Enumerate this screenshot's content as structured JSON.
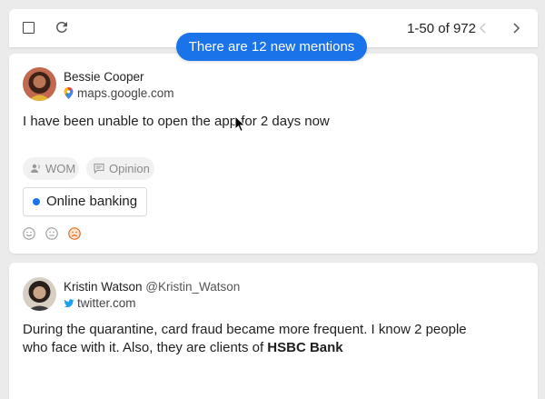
{
  "toolbar": {
    "pagination_text": "1-50 of 972"
  },
  "banner": {
    "text": "There are 12 new mentions"
  },
  "mentions": [
    {
      "author": "Bessie Cooper",
      "handle": "",
      "source": "maps.google.com",
      "source_icon": "google-maps-pin-icon",
      "text": "I have been unable to open the app for 2 days now",
      "tags": [
        {
          "label": "WOM",
          "icon": "people-voice-icon"
        },
        {
          "label": "Opinion",
          "icon": "chat-bubble-icon"
        }
      ],
      "topic": "Online banking",
      "topic_color": "#1a73e8",
      "sentiments": [
        "positive-face-icon",
        "neutral-face-icon",
        "negative-face-icon"
      ],
      "selected_sentiment": "negative",
      "selected_sentiment_color": "#e36c1c"
    },
    {
      "author": "Kristin Watson",
      "handle": "@Kristin_Watson",
      "source": "twitter.com",
      "source_icon": "twitter-bird-icon",
      "text_plain": "During the quarantine, card fraud became more frequent. I know 2 people who face with it. Also, they are clients of ",
      "text_bold": "HSBC Bank"
    }
  ],
  "colors": {
    "accent": "#1a73e8",
    "background": "#ebebeb",
    "twitter": "#1da1f2"
  }
}
